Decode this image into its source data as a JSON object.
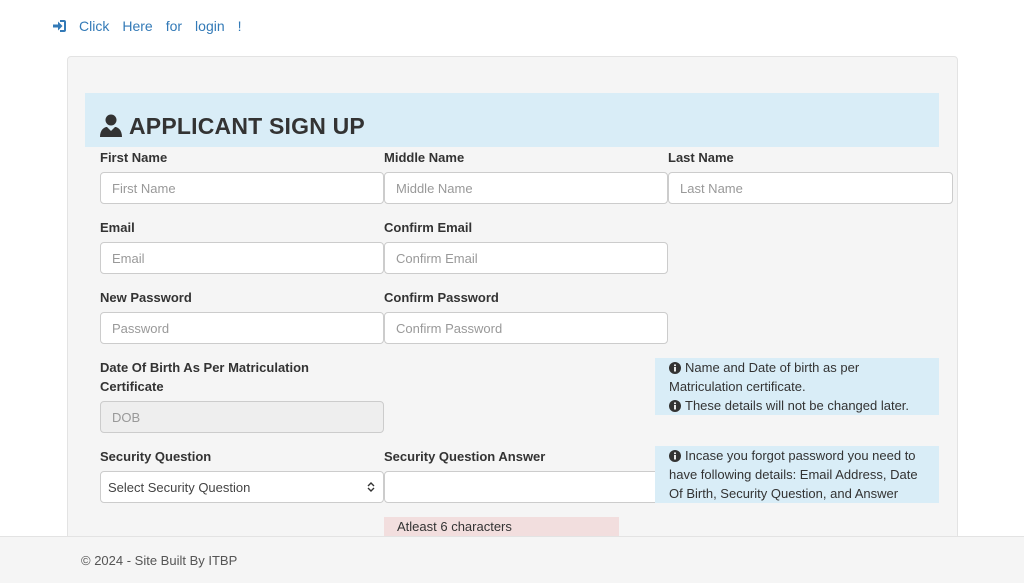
{
  "login_link": {
    "icon": "sign-in-icon",
    "words": [
      "Click",
      "Here",
      "for",
      "login",
      "!"
    ]
  },
  "header": {
    "icon": "user-icon",
    "title": "APPLICANT SIGN UP"
  },
  "fields": {
    "first_name": {
      "label": "First Name",
      "placeholder": "First Name"
    },
    "middle_name": {
      "label": "Middle Name",
      "placeholder": "Middle Name"
    },
    "last_name": {
      "label": "Last Name",
      "placeholder": "Last Name"
    },
    "email": {
      "label": "Email",
      "placeholder": "Email"
    },
    "confirm_email": {
      "label": "Confirm Email",
      "placeholder": "Confirm Email"
    },
    "new_password": {
      "label": "New Password",
      "placeholder": "Password"
    },
    "confirm_password": {
      "label": "Confirm Password",
      "placeholder": "Confirm Password"
    },
    "dob": {
      "label_line1": "Date Of Birth As Per Matriculation",
      "label_line2": "Certificate",
      "placeholder": "DOB"
    },
    "security_question": {
      "label": "Security Question",
      "selected": "Select Security Question"
    },
    "security_answer": {
      "label": "Security Question Answer",
      "value": ""
    }
  },
  "info_dob": {
    "icon": "info-circle-icon",
    "line1": "Name and Date of birth as per",
    "line2": "Matriculation certificate.",
    "line3": "These details will not be changed later."
  },
  "info_recovery": {
    "icon": "info-circle-icon",
    "line1": "Incase you forgot password you need to",
    "line2": "have following details: Email Address, Date",
    "line3": "Of Birth, Security Question, and Answer"
  },
  "password_hint": "Atleast 6 characters",
  "footer": {
    "text": "© 2024 - Site Built By ITBP"
  },
  "colors": {
    "link": "#337ab7",
    "info_bg": "#d9edf7",
    "warn_bg": "#f2dede",
    "panel_bg": "#f5f5f5"
  }
}
